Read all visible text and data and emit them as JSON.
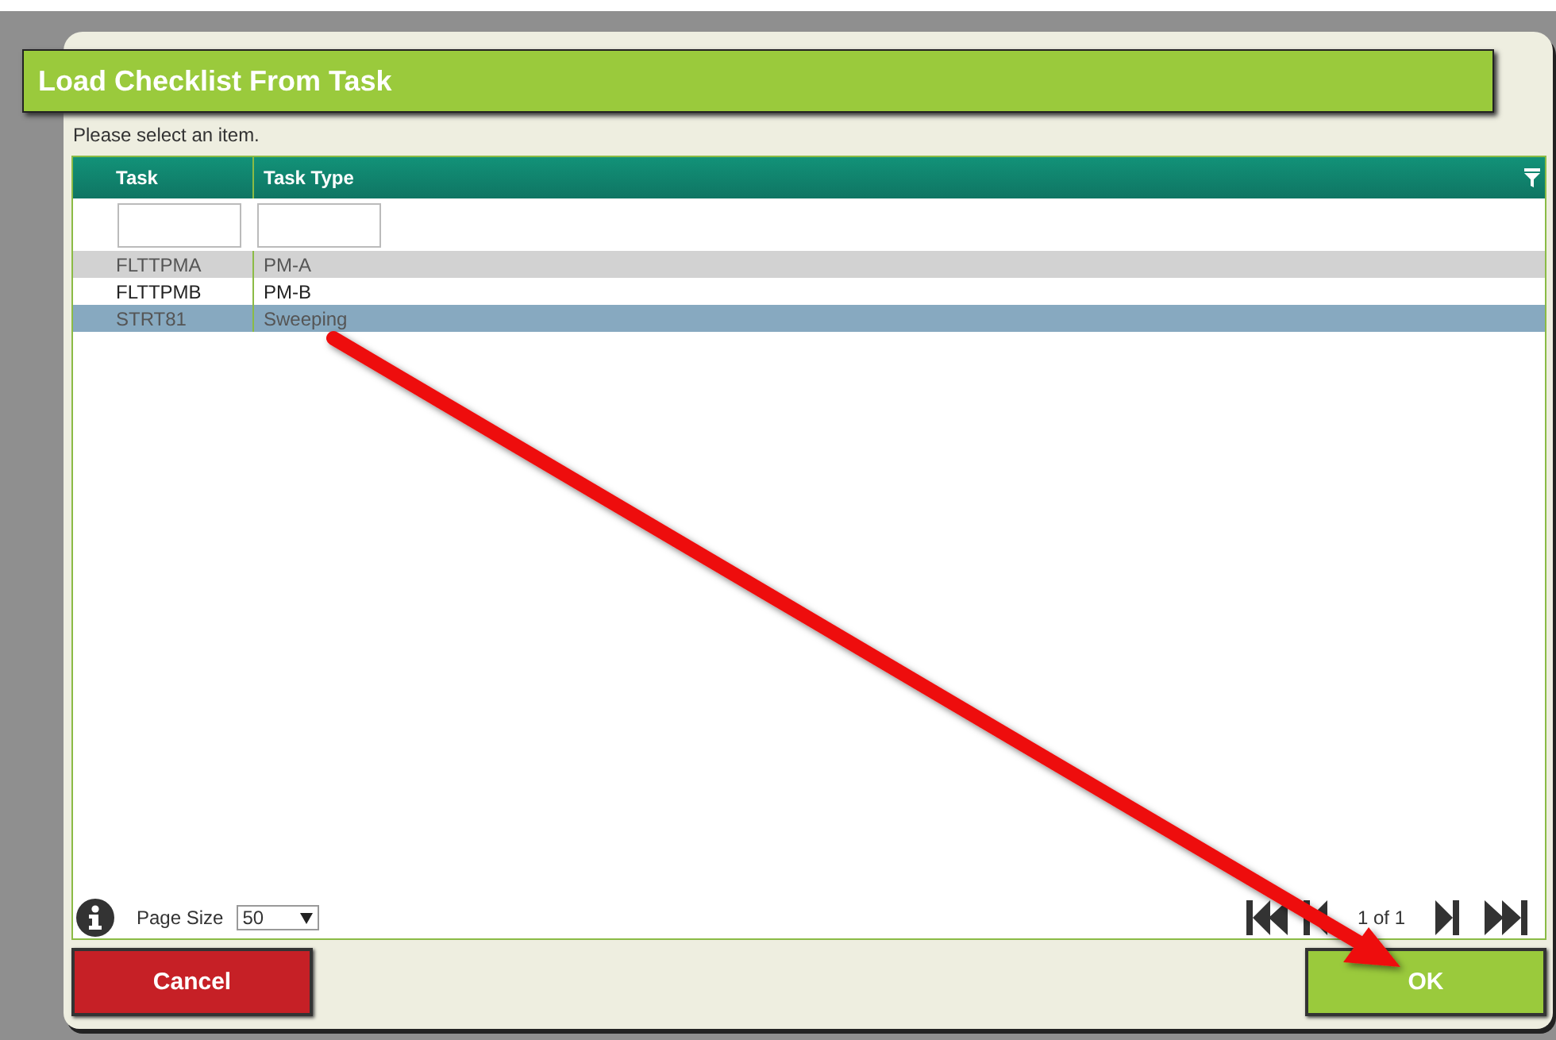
{
  "dialog": {
    "title": "Load Checklist From Task",
    "prompt": "Please select an item."
  },
  "grid": {
    "columns": [
      "Task",
      "Task Type"
    ],
    "rows": [
      {
        "cells": [
          "FLTTPMA",
          "PM-A"
        ],
        "selected": false
      },
      {
        "cells": [
          "FLTTPMB",
          "PM-B"
        ],
        "selected": false
      },
      {
        "cells": [
          "STRT81",
          "Sweeping"
        ],
        "selected": true
      }
    ],
    "page_size_label": "Page Size",
    "page_size": "50",
    "page_info": "1 of 1"
  },
  "buttons": [
    {
      "label": "Cancel",
      "kind": "cancel"
    },
    {
      "label": "OK",
      "kind": "ok"
    }
  ],
  "annotation": {
    "kind": "arrow"
  }
}
